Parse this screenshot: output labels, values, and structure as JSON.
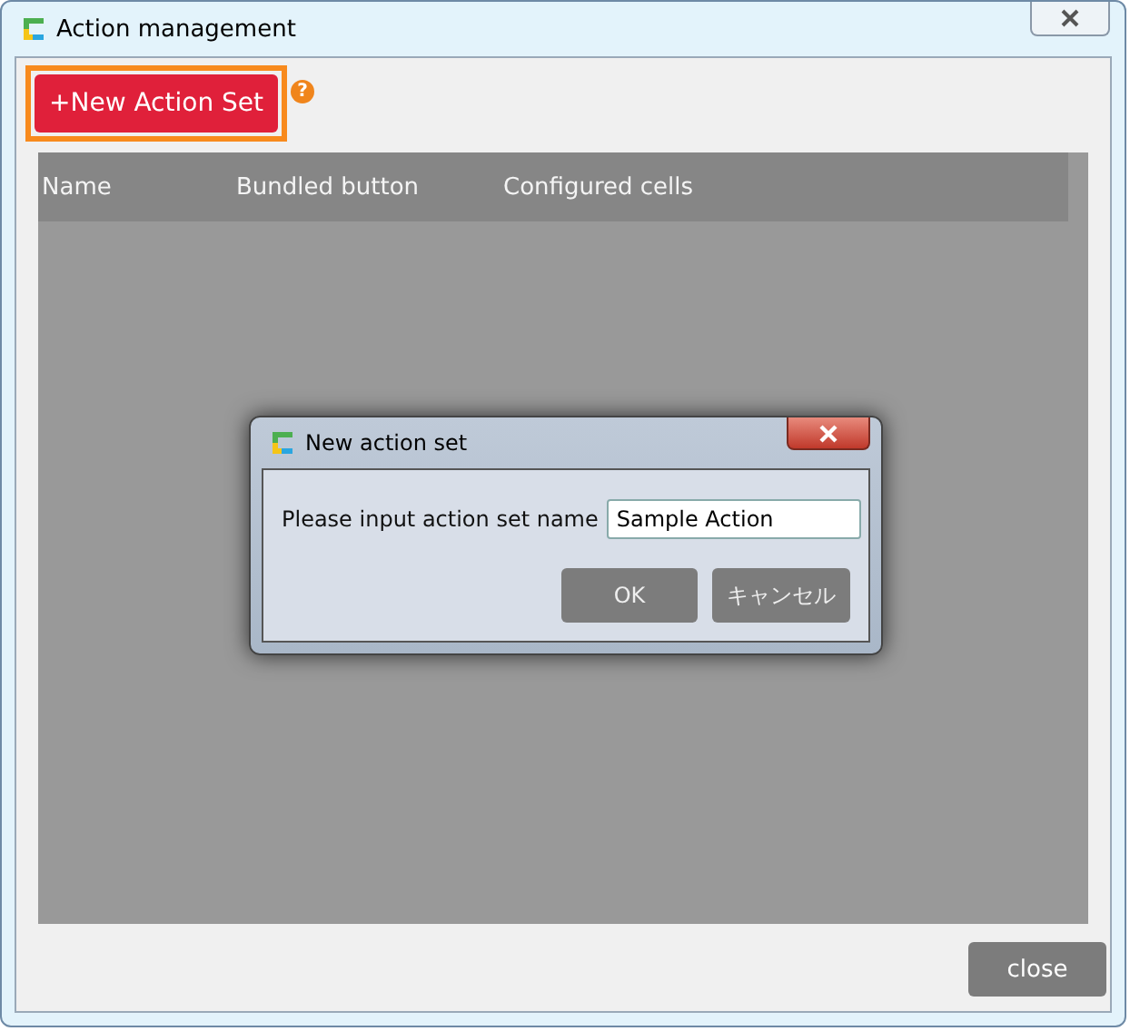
{
  "window": {
    "title": "Action management"
  },
  "new_button": {
    "label": "+New Action Set"
  },
  "help": {
    "label": "?"
  },
  "table": {
    "columns": [
      "Name",
      "Bundled button",
      "Configured cells"
    ]
  },
  "dialog": {
    "title": "New action set",
    "prompt": "Please input action set name",
    "name_field": {
      "value": "Sample Action"
    },
    "buttons": [
      "OK",
      "キャンセル"
    ]
  },
  "close_button": {
    "label": "close"
  }
}
